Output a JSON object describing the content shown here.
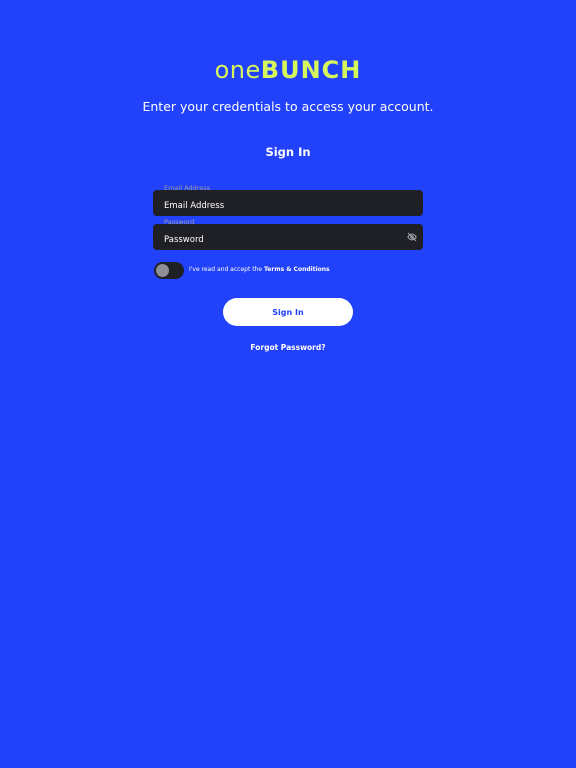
{
  "brand": {
    "logo_part1": "one",
    "logo_part2": "BUNCH",
    "logo_color": "#d5f75c"
  },
  "subtitle": "Enter your credentials to access your account.",
  "heading": "Sign In",
  "form": {
    "email": {
      "label": "Email Address",
      "placeholder": "Email Address",
      "value": ""
    },
    "password": {
      "label": "Password",
      "placeholder": "Password",
      "value": "",
      "visibility_icon": "eye-off-icon"
    },
    "terms": {
      "checked": false,
      "text": "I've read and accept the",
      "link": "Terms & Conditions"
    },
    "submit_label": "Sign In",
    "forgot_label": "Forgot Password?"
  },
  "colors": {
    "background": "#2241fb",
    "field_background": "#1f2026",
    "button_background": "#ffffff",
    "button_text": "#2241fb"
  }
}
